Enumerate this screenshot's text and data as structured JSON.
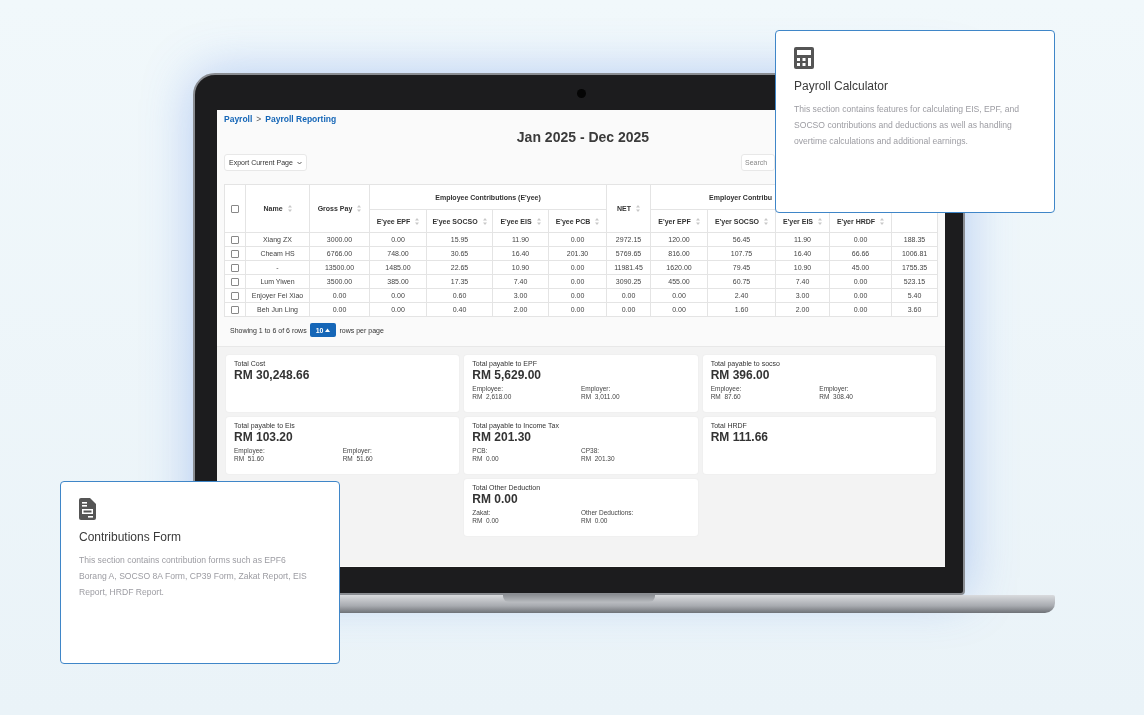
{
  "breadcrumb": {
    "items": [
      {
        "label": "Payroll"
      },
      {
        "label": "Payroll Reporting"
      }
    ],
    "separator": ">"
  },
  "title": "Jan 2025 - Dec 2025",
  "export_select": {
    "value": "Export Current Page"
  },
  "search": {
    "placeholder": "Search"
  },
  "table": {
    "select_all": {
      "checked": false
    },
    "columns": [
      {
        "label": "Name"
      },
      {
        "label": "Gross Pay"
      },
      {
        "group": "Employee Contributions (E'yee)",
        "colspan": 4,
        "columns": [
          {
            "label": "E'yee EPF"
          },
          {
            "label": "E'yee SOCSO"
          },
          {
            "label": "E'yee EIS"
          },
          {
            "label": "E'yee PCB"
          }
        ]
      },
      {
        "label": "NET"
      },
      {
        "group": "Employer Contribu",
        "colspan": 5,
        "columns": [
          {
            "label": "E'yer EPF"
          },
          {
            "label": "E'yer SOCSO"
          },
          {
            "label": "E'yer EIS"
          },
          {
            "label": "E'yer HRDF"
          }
        ]
      }
    ],
    "rows": [
      {
        "checked": false,
        "cells": [
          "Xiang ZX",
          "3000.00",
          "0.00",
          "15.95",
          "11.90",
          "0.00",
          "2972.15",
          "120.00",
          "56.45",
          "11.90",
          "0.00",
          "188.35"
        ]
      },
      {
        "checked": false,
        "cells": [
          "Cheam HS",
          "6766.00",
          "748.00",
          "30.65",
          "16.40",
          "201.30",
          "5769.65",
          "816.00",
          "107.75",
          "16.40",
          "66.66",
          "1006.81"
        ]
      },
      {
        "checked": false,
        "cells": [
          "-",
          "13500.00",
          "1485.00",
          "22.65",
          "10.90",
          "0.00",
          "11981.45",
          "1620.00",
          "79.45",
          "10.90",
          "45.00",
          "1755.35"
        ]
      },
      {
        "checked": false,
        "cells": [
          "Lum Yiwen",
          "3500.00",
          "385.00",
          "17.35",
          "7.40",
          "0.00",
          "3090.25",
          "455.00",
          "60.75",
          "7.40",
          "0.00",
          "523.15"
        ]
      },
      {
        "checked": false,
        "cells": [
          "Enjoyer Fei Xiao",
          "0.00",
          "0.00",
          "0.60",
          "3.00",
          "0.00",
          "0.00",
          "0.00",
          "2.40",
          "3.00",
          "0.00",
          "5.40"
        ]
      },
      {
        "checked": false,
        "cells": [
          "Beh Jun Ling",
          "0.00",
          "0.00",
          "0.40",
          "2.00",
          "0.00",
          "0.00",
          "0.00",
          "1.60",
          "2.00",
          "0.00",
          "3.60"
        ]
      }
    ]
  },
  "pagination": {
    "summary": "Showing 1 to 6 of 6 rows",
    "page_size": "10",
    "page_size_label": "rows per page"
  },
  "summary_cards": [
    {
      "title": "Total Cost",
      "value": "RM 30,248.66"
    },
    {
      "title": "Total payable to EPF",
      "value": "RM 5,629.00",
      "details": [
        {
          "label": "Employee:",
          "value": "RM  2,618.00"
        },
        {
          "label": "Employer:",
          "value": "RM  3,011.00"
        }
      ]
    },
    {
      "title": "Total payable to socso",
      "value": "RM 396.00",
      "details": [
        {
          "label": "Employee:",
          "value": "RM  87.60"
        },
        {
          "label": "Employer:",
          "value": "RM  308.40"
        }
      ]
    },
    {
      "title": "Total payable to Eis",
      "value": "RM 103.20",
      "details": [
        {
          "label": "Employee:",
          "value": "RM  51.60"
        },
        {
          "label": "Employer:",
          "value": "RM  51.60"
        }
      ]
    },
    {
      "title": "Total payable to Income Tax",
      "value": "RM 201.30",
      "details": [
        {
          "label": "PCB:",
          "value": "RM  0.00"
        },
        {
          "label": "CP38:",
          "value": "RM  201.30"
        }
      ]
    },
    {
      "title": "Total HRDF",
      "value": "RM 111.66"
    },
    {
      "title": "Total Other Deduction",
      "value": "RM 0.00",
      "details": [
        {
          "label": "Zakat:",
          "value": "RM  0.00"
        },
        {
          "label": "Other Deductions:",
          "value": "RM  0.00"
        }
      ]
    }
  ],
  "feature_cards": [
    {
      "kind": "calculator",
      "title": "Payroll Calculator",
      "description": "This section contains features for calculating EIS, EPF, and SOCSO contributions and deductions as well as handling overtime calculations and additional earnings."
    },
    {
      "kind": "form",
      "title": "Contributions Form",
      "description": "This section contains contribution forms such as EPF6 Borang A, SOCSO 8A Form, CP39 Form, Zakat Report, EIS Report, HRDF Report."
    }
  ]
}
